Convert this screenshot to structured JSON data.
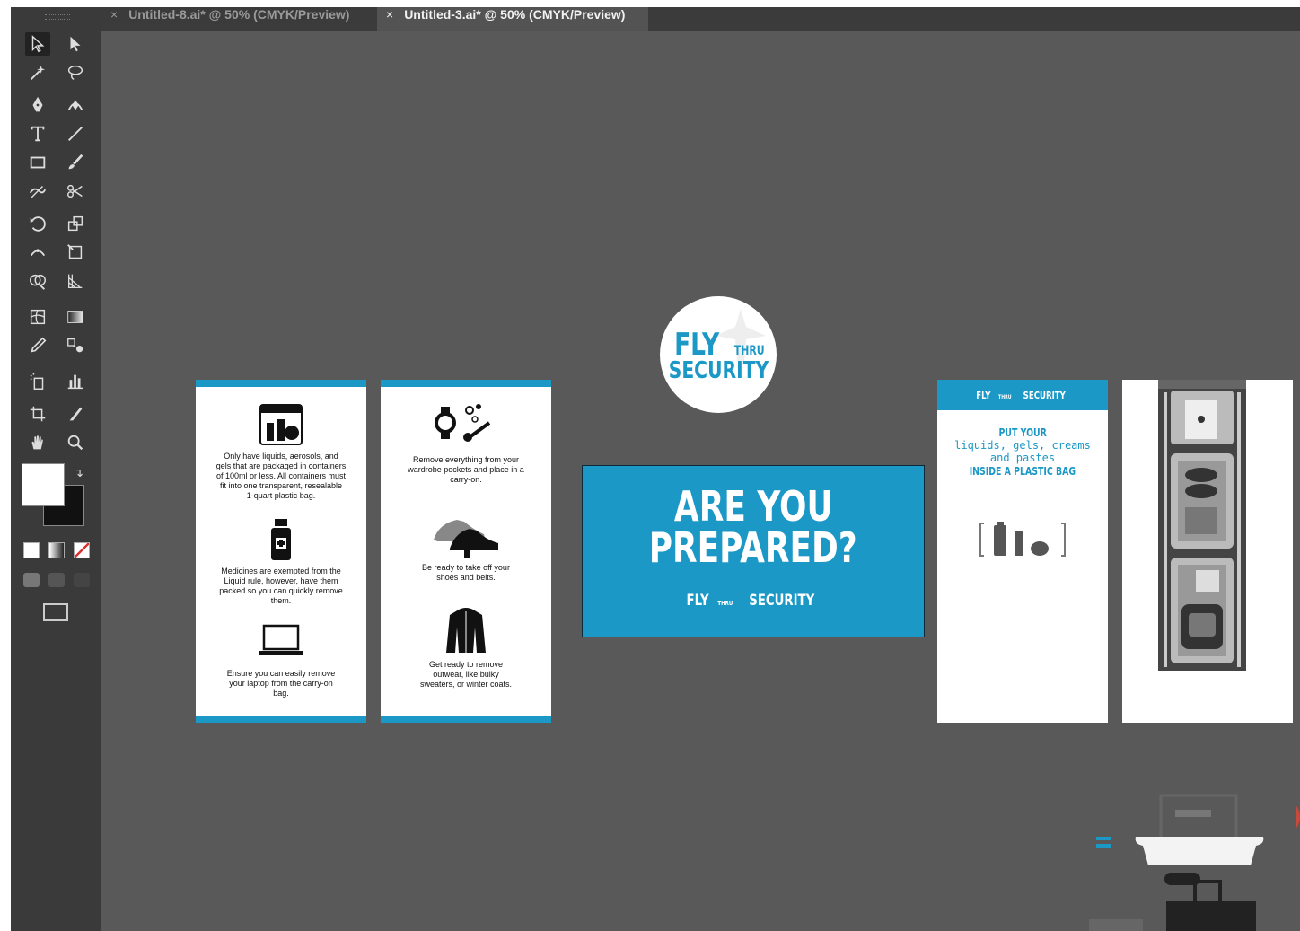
{
  "tabs": [
    {
      "label": "Untitled-8.ai* @ 50% (CMYK/Preview)",
      "active": false
    },
    {
      "label": "Untitled-3.ai* @ 50% (CMYK/Preview)",
      "active": true
    }
  ],
  "tab_close": "×",
  "tools": [
    "selection-tool",
    "direct-selection-tool",
    "magic-wand-tool",
    "lasso-tool",
    "pen-tool",
    "curvature-tool",
    "type-tool",
    "line-segment-tool",
    "rectangle-tool",
    "paintbrush-tool",
    "shaper-tool",
    "scissors-tool",
    "rotate-tool",
    "scale-tool",
    "width-tool",
    "free-transform-tool",
    "shape-builder-tool",
    "perspective-grid-tool",
    "mesh-tool",
    "gradient-tool",
    "eyedropper-tool",
    "blend-tool",
    "symbol-sprayer-tool",
    "column-graph-tool",
    "artboard-tool",
    "slice-tool",
    "hand-tool",
    "zoom-tool"
  ],
  "artwork": {
    "panel1": {
      "item1": "Only have liquids, aerosols, and gels that are packaged in containers of 100ml or less. All containers must fit into one transparent, resealable 1-quart plastic bag.",
      "item2": "Medicines are exempted from the Liquid rule, however, have them packed so you can quickly remove them.",
      "item3": "Ensure you can easily remove your laptop from the carry-on bag."
    },
    "panel2": {
      "item1": "Remove everything from your wardrobe pockets and place in a carry-on.",
      "item2": "Be ready to take off your shoes and belts.",
      "item3": "Get ready to remove outwear, like bulky sweaters, or winter coats."
    },
    "logo": {
      "fly": "FLY",
      "thru": "THRU",
      "security": "SECURITY"
    },
    "banner": {
      "line1": "ARE YOU",
      "line2": "PREPARED?",
      "brand_fly": "FLY",
      "brand_thru": "THRU",
      "brand_security": "SECURITY"
    },
    "panel4": {
      "header_fly": "FLY",
      "header_thru": "THRU",
      "header_security": "SECURITY",
      "put_your": "PUT YOUR",
      "liquids": "liquids, gels, creams",
      "and_pastes": "and pastes",
      "inside": "INSIDE A PLASTIC BAG"
    }
  },
  "colors": {
    "accent": "#1c98c6",
    "canvas": "#595959",
    "toolbar": "#3a3a3a"
  }
}
